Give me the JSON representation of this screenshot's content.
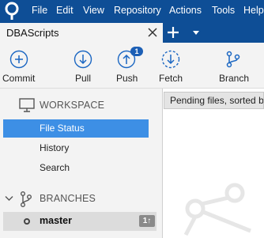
{
  "menubar": {
    "items": [
      "File",
      "Edit",
      "View",
      "Repository",
      "Actions",
      "Tools",
      "Help"
    ]
  },
  "tab": {
    "title": "DBAScripts"
  },
  "toolbar": {
    "commit": "Commit",
    "pull": "Pull",
    "push": "Push",
    "push_badge": "1",
    "fetch": "Fetch",
    "branch": "Branch"
  },
  "sidebar": {
    "workspace_header": "WORKSPACE",
    "items": [
      "File Status",
      "History",
      "Search"
    ],
    "selected_item": "File Status",
    "branches_header": "BRANCHES",
    "branch": {
      "name": "master",
      "ahead": "1↑"
    }
  },
  "main": {
    "pending_label": "Pending files, sorted by"
  },
  "colors": {
    "title_bar": "#0e4e96",
    "selection": "#3d8fe5",
    "badge": "#1c5fb5",
    "icon_blue": "#1a66c2"
  }
}
